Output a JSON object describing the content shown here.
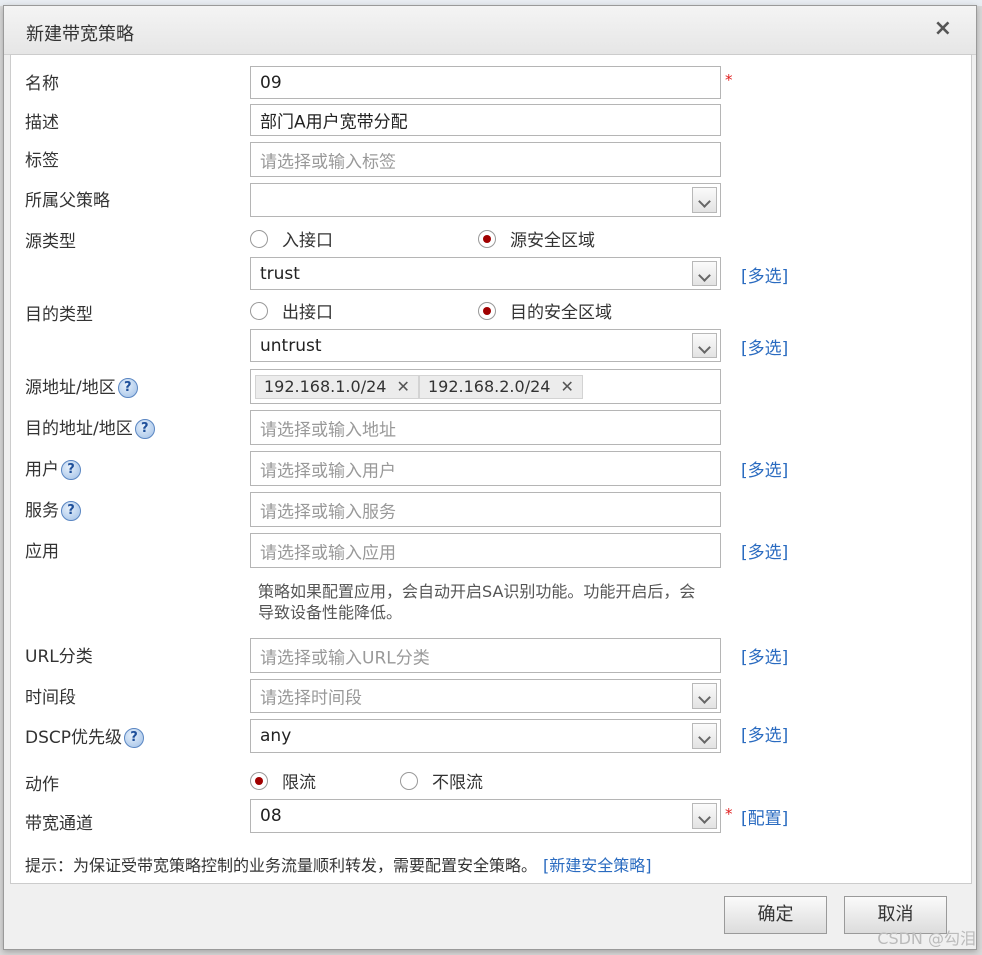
{
  "dialog": {
    "title": "新建带宽策略",
    "close": "×"
  },
  "labels": {
    "name": "名称",
    "desc": "描述",
    "tags": "标签",
    "parent": "所属父策略",
    "src_type": "源类型",
    "dst_type": "目的类型",
    "src_addr": "源地址/地区",
    "dst_addr": "目的地址/地区",
    "user": "用户",
    "service": "服务",
    "app": "应用",
    "url": "URL分类",
    "time": "时间段",
    "dscp": "DSCP优先级",
    "action": "动作",
    "channel": "带宽通道"
  },
  "fields": {
    "name": "09",
    "desc": "部门A用户宽带分配",
    "tags_ph": "请选择或输入标签",
    "parent": "",
    "src_zone": "trust",
    "dst_zone": "untrust",
    "src_addrs": [
      "192.168.1.0/24",
      "192.168.2.0/24"
    ],
    "dst_addr_ph": "请选择或输入地址",
    "user_ph": "请选择或输入用户",
    "service_ph": "请选择或输入服务",
    "app_ph": "请选择或输入应用",
    "app_note": "策略如果配置应用，会自动开启SA识别功能。功能开启后，会导致设备性能降低。",
    "url_ph": "请选择或输入URL分类",
    "time_ph": "请选择时间段",
    "dscp": "any",
    "channel": "08"
  },
  "radios": {
    "src_in_if": "入接口",
    "src_zone": "源安全区域",
    "dst_out_if": "出接口",
    "dst_zone": "目的安全区域",
    "limit": "限流",
    "nolimit": "不限流"
  },
  "links": {
    "multi": "[多选]",
    "config": "[配置]",
    "new_policy": "[新建安全策略]"
  },
  "required_mark": "*",
  "help_icon": "?",
  "tag_remove": "✕",
  "hint": "提示：为保证受带宽策略控制的业务流量顺利转发，需要配置安全策略。",
  "buttons": {
    "ok": "确定",
    "cancel": "取消"
  },
  "watermark": "CSDN @勾泪",
  "colors": {
    "link": "#2a6bc0",
    "required": "#e02020",
    "radio_on": "#a00000"
  }
}
